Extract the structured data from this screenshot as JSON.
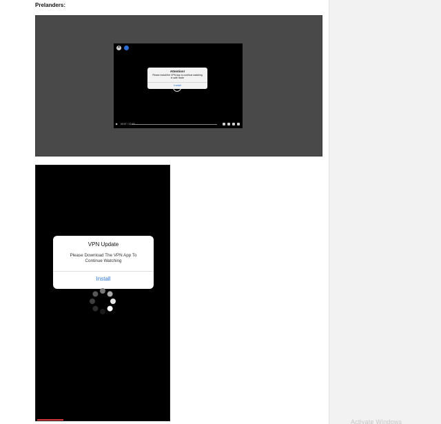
{
  "section": {
    "heading": "Prelanders:"
  },
  "prelander_1": {
    "dialog": {
      "title": "Attention!",
      "message": "Please Install the VPN App to continue watching in safe mode",
      "button_label": "Install"
    },
    "player": {
      "time": "00:07 / 22:48"
    }
  },
  "prelander_2": {
    "dialog": {
      "title": "VPN Update",
      "message": "Please Download The VPN App To Continue Watching",
      "button_label": "Install"
    }
  },
  "watermark": {
    "text": "Activate Windows"
  },
  "colors": {
    "accent": "#2a74d6",
    "panel_bg": "#494949",
    "phone_bg": "#000000"
  }
}
